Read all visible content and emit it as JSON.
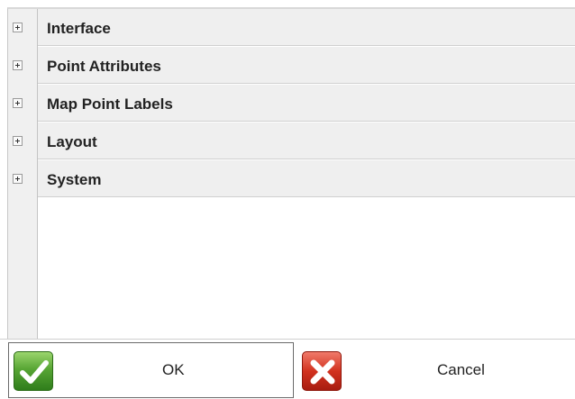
{
  "settings_tree": {
    "sections": [
      {
        "label": "Interface"
      },
      {
        "label": "Point Attributes"
      },
      {
        "label": "Map Point Labels"
      },
      {
        "label": "Layout"
      },
      {
        "label": "System"
      }
    ]
  },
  "dialog_buttons": {
    "ok_label": "OK",
    "cancel_label": "Cancel",
    "ok_icon": "checkmark-icon",
    "cancel_icon": "x-icon"
  },
  "colors": {
    "ok_green": "#4a9a2c",
    "cancel_red": "#d2321f",
    "header_bg": "#efefef"
  }
}
